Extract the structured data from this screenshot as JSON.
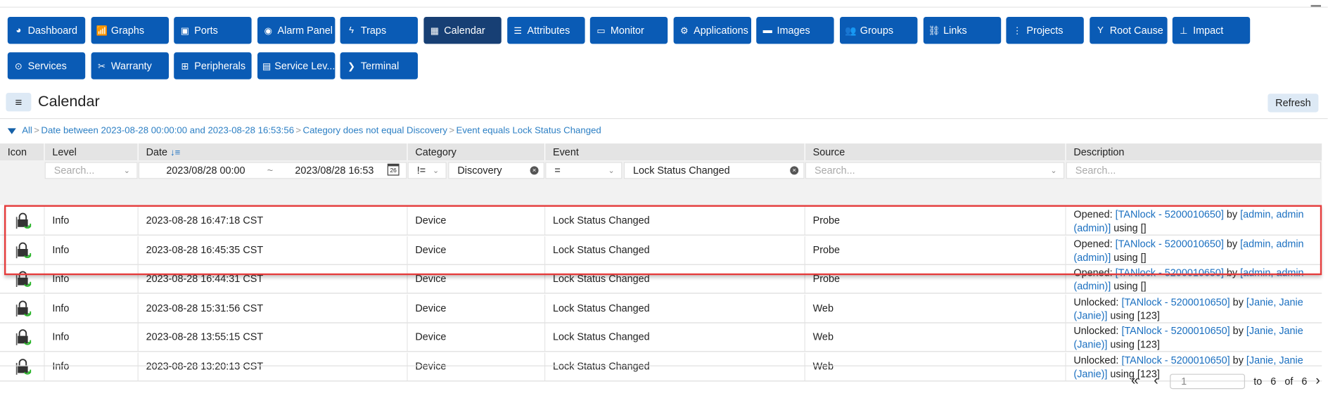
{
  "nav": [
    {
      "label": "Dashboard",
      "icon": "dashboard-icon"
    },
    {
      "label": "Graphs",
      "icon": "graphs-icon"
    },
    {
      "label": "Ports",
      "icon": "ports-icon"
    },
    {
      "label": "Alarm Panel",
      "icon": "alarm-icon"
    },
    {
      "label": "Traps",
      "icon": "traps-icon"
    },
    {
      "label": "Calendar",
      "icon": "calendar-icon",
      "active": true
    },
    {
      "label": "Attributes",
      "icon": "attributes-icon"
    },
    {
      "label": "Monitor",
      "icon": "monitor-icon"
    },
    {
      "label": "Applications",
      "icon": "applications-icon"
    },
    {
      "label": "Images",
      "icon": "images-icon"
    },
    {
      "label": "Groups",
      "icon": "groups-icon"
    },
    {
      "label": "Links",
      "icon": "links-icon"
    },
    {
      "label": "Projects",
      "icon": "projects-icon"
    },
    {
      "label": "Root Cause",
      "icon": "root-cause-icon"
    },
    {
      "label": "Impact",
      "icon": "impact-icon"
    },
    {
      "label": "Services",
      "icon": "services-icon"
    },
    {
      "label": "Warranty",
      "icon": "warranty-icon"
    },
    {
      "label": "Peripherals",
      "icon": "peripherals-icon"
    },
    {
      "label": "Service Lev...",
      "icon": "sla-icon"
    },
    {
      "label": "Terminal",
      "icon": "terminal-icon"
    }
  ],
  "header": {
    "menu": "≡",
    "title": "Calendar",
    "refresh": "Refresh"
  },
  "breadcrumb": [
    "All",
    "Date between 2023-08-28 00:00:00 and 2023-08-28 16:53:56",
    "Category does not equal Discovery",
    "Event equals Lock Status Changed"
  ],
  "columns": [
    "Icon",
    "Level",
    "Date",
    "Category",
    "Event",
    "Source",
    "Description"
  ],
  "filters": {
    "level_placeholder": "Search...",
    "date_from": "2023/08/28 00:00",
    "date_sep": "~",
    "date_to": "2023/08/28 16:53",
    "category_op": "!=",
    "category_value": "Discovery",
    "event_op": "=",
    "event_value": "Lock Status Changed",
    "source_placeholder": "Search...",
    "description_placeholder": "Search..."
  },
  "rows": [
    {
      "level": "Info",
      "date": "2023-08-28 16:47:18 CST",
      "category": "Device",
      "event": "Lock Status Changed",
      "source": "Probe",
      "d_action": "Opened: ",
      "d_lock": "[TANlock - 5200010650]",
      "d_by": " by ",
      "d_user": "[admin, admin (admin)]",
      "d_using": " using []"
    },
    {
      "level": "Info",
      "date": "2023-08-28 16:45:35 CST",
      "category": "Device",
      "event": "Lock Status Changed",
      "source": "Probe",
      "d_action": "Opened: ",
      "d_lock": "[TANlock - 5200010650]",
      "d_by": " by ",
      "d_user": "[admin, admin (admin)]",
      "d_using": " using []"
    },
    {
      "level": "Info",
      "date": "2023-08-28 16:44:31 CST",
      "category": "Device",
      "event": "Lock Status Changed",
      "source": "Probe",
      "d_action": "Opened: ",
      "d_lock": "[TANlock - 5200010650]",
      "d_by": " by ",
      "d_user": "[admin, admin (admin)]",
      "d_using": " using []"
    },
    {
      "level": "Info",
      "date": "2023-08-28 15:31:56 CST",
      "category": "Device",
      "event": "Lock Status Changed",
      "source": "Web",
      "d_action": "Unlocked: ",
      "d_lock": "[TANlock - 5200010650]",
      "d_by": " by ",
      "d_user": "[Janie, Janie (Janie)]",
      "d_using": " using [123]"
    },
    {
      "level": "Info",
      "date": "2023-08-28 13:55:15 CST",
      "category": "Device",
      "event": "Lock Status Changed",
      "source": "Web",
      "d_action": "Unlocked: ",
      "d_lock": "[TANlock - 5200010650]",
      "d_by": " by ",
      "d_user": "[Janie, Janie (Janie)]",
      "d_using": " using [123]"
    },
    {
      "level": "Info",
      "date": "2023-08-28 13:20:13 CST",
      "category": "Device",
      "event": "Lock Status Changed",
      "source": "Web",
      "d_action": "Unlocked: ",
      "d_lock": "[TANlock - 5200010650]",
      "d_by": " by ",
      "d_user": "[Janie, Janie (Janie)]",
      "d_using": " using [123]"
    }
  ],
  "pager": {
    "first": "«",
    "prev": "‹",
    "page": "1",
    "to_label": "to",
    "to": "6",
    "of_label": "of",
    "total": "6",
    "next": "›",
    "last": "»"
  },
  "colors": {
    "nav": "#0a5bb5",
    "nav_active": "#173f74",
    "link": "#1a6fc0",
    "highlight": "#e53c3c"
  }
}
